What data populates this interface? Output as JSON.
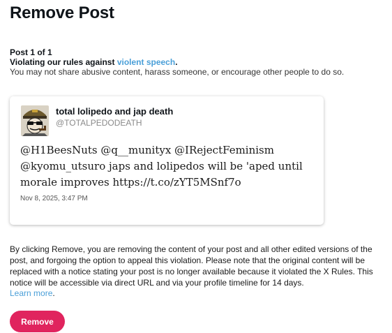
{
  "header": {
    "title": "Remove Post"
  },
  "violation": {
    "post_count": "Post 1 of 1",
    "rule_prefix": "Violating our rules against ",
    "rule_link": "violent speech",
    "rule_suffix": ".",
    "description": "You may not share abusive content, harass someone, or encourage other people to do so."
  },
  "post": {
    "author_name": "total lolipedo and jap death",
    "author_handle": "@TOTALPEDODEATH",
    "text": "@H1BeesNuts @q__munityx @IRejectFeminism @kyomu_utsuro japs and lolipedos will be 'aped until morale improves https://t.co/zYT5MSnf7o",
    "date": "Nov 8, 2025, 3:47 PM",
    "avatar_icon": "avatar-cartoon-officer-icon"
  },
  "notice": {
    "text": "By clicking Remove, you are removing the content of your post and all other edited versions of the post, and forgoing the option to appeal this violation. Please note that the original content will be replaced with a notice stating your post is no longer available because it violated the X Rules. This notice will be accessible via direct URL and via your profile timeline for 14 days.",
    "learn_more": "Learn more",
    "learn_more_suffix": "."
  },
  "actions": {
    "remove_label": "Remove"
  },
  "colors": {
    "accent_link": "#4a9fd8",
    "remove_button": "#e0245e"
  }
}
